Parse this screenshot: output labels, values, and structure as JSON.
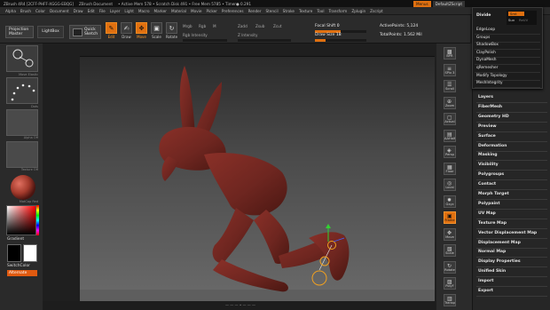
{
  "titlebar": {
    "text": "ZBrush 4R4 [2CFF-PHFF-XGGG-EBQG]",
    "doc": "ZBrush Document",
    "mem": "• Active Mem 578 • Scratch Disk 491 • Free Mem 5785 • Timer● 0.291",
    "menus_btn": "Menus",
    "script_btn": "DefaultZScript"
  },
  "menubar": [
    "Alpha",
    "Brush",
    "Color",
    "Document",
    "Draw",
    "Edit",
    "File",
    "Layer",
    "Light",
    "Macro",
    "Marker",
    "Material",
    "Movie",
    "Picker",
    "Preferences",
    "Render",
    "Stencil",
    "Stroke",
    "Texture",
    "Tool",
    "Transform",
    "Zplugin",
    "Zscript"
  ],
  "toolbar": {
    "projection_master": "Projection Master",
    "lightbox": "LightBox",
    "quick_sketch": "Quick Sketch",
    "tools": [
      {
        "label": "Edit",
        "icon": "✎",
        "on": true
      },
      {
        "label": "Draw",
        "icon": "✍",
        "on": false
      },
      {
        "label": "Move",
        "icon": "✥",
        "on": true
      },
      {
        "label": "Scale",
        "icon": "▣",
        "on": false
      },
      {
        "label": "Rotate",
        "icon": "↻",
        "on": false
      }
    ],
    "mrgb": "Mrgb",
    "rgb": "Rgb",
    "m": "M",
    "zadd": "Zadd",
    "zsub": "Zsub",
    "zcut": "Zcut",
    "rgb_intensity": "Rgb Intensity",
    "z_intensity": "Z Intensity",
    "focal_shift_label": "Focal Shift",
    "focal_shift_value": "0",
    "draw_size_label": "Draw Size",
    "draw_size_value": "18",
    "active_points": "ActivePoints: 5,124",
    "total_points": "TotalPoints: 1.562 Mil"
  },
  "leftshelf": {
    "brush_label": "Move Elastic",
    "stroke_label": "Dots",
    "alpha_label": "Alpha Off",
    "texture_label": "Texture Off",
    "material_label": "MatCap Red",
    "gradient": "Gradient",
    "switch_color": "SwitchColor",
    "alternate": "Alternate"
  },
  "rshelf": [
    {
      "label": "BPR",
      "glyph": "▩"
    },
    {
      "label": "SPix 3",
      "glyph": "≡"
    },
    {
      "label": "Scroll",
      "glyph": "☰"
    },
    {
      "label": "Zoom",
      "glyph": "⊕"
    },
    {
      "label": "Actual",
      "glyph": "▢"
    },
    {
      "label": "AAHalf",
      "glyph": "▤"
    },
    {
      "label": "Persp",
      "glyph": "◈"
    },
    {
      "label": "Floor",
      "glyph": "▦"
    },
    {
      "label": "Local",
      "glyph": "◎"
    },
    {
      "label": "Gxyz",
      "glyph": "✹"
    },
    {
      "label": "Frame",
      "glyph": "▣"
    },
    {
      "label": "Move",
      "glyph": "✥"
    },
    {
      "label": "Scale",
      "glyph": "▧"
    },
    {
      "label": "Rotate",
      "glyph": "↻"
    },
    {
      "label": "PolyF",
      "glyph": "▨"
    },
    {
      "label": "Transp",
      "glyph": "▥"
    }
  ],
  "palette": {
    "popup_header": "Divide",
    "popup_smt": "Smt",
    "popup_suv": "Suv",
    "popup_reuv": "ReUV",
    "popup_items": [
      "EdgeLoop",
      "Groups",
      "ShadowBox",
      "ClayPolish",
      "DynaMesh",
      "qRemesher",
      "Modify Topology",
      "MeshIntegrity"
    ],
    "items": [
      "Layers",
      "FiberMesh",
      "Geometry HD",
      "Preview",
      "Surface",
      "Deformation",
      "Masking",
      "Visibility",
      "Polygroups",
      "Contact",
      "Morph Target",
      "Polypaint",
      "UV Map",
      "Texture Map",
      "Vector Displacement Map",
      "Displacement Map",
      "Normal Map",
      "Display Properties",
      "Unified Skin",
      "Import",
      "Export"
    ]
  },
  "viewport_mark": "— — — • — — —",
  "colors": {
    "accent": "#e07010",
    "model": "#7a2a24",
    "bg": "#1f1f1f"
  }
}
